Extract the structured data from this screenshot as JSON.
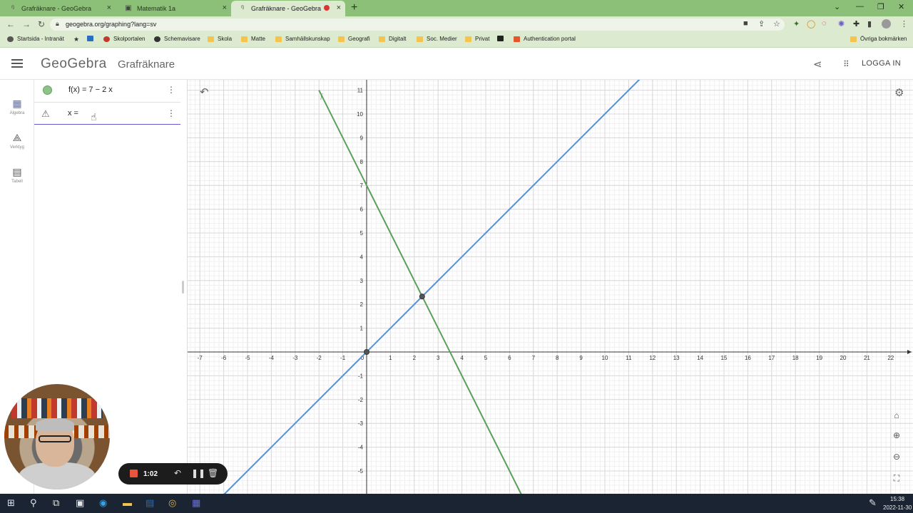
{
  "browser": {
    "tabs": [
      {
        "title": "Grafräknare - GeoGebra",
        "active": false,
        "icon": "geogebra-icon"
      },
      {
        "title": "Matematik 1a",
        "active": false,
        "icon": "video-icon"
      },
      {
        "title": "Grafräknare - GeoGebra",
        "active": true,
        "icon": "geogebra-icon"
      }
    ],
    "url": "geogebra.org/graphing?lang=sv",
    "bookmarks": [
      "Startsida - Intranät",
      "Skolportalen",
      "Schemavisare",
      "Skola",
      "Matte",
      "Samhällskunskap",
      "Geografi",
      "Digitalt",
      "Soc. Medier",
      "Privat",
      "Authentication portal"
    ],
    "other_bookmarks": "Övriga bokmärken"
  },
  "app": {
    "logo": "GeoGebra",
    "name": "Grafräknare",
    "login": "LOGGA IN"
  },
  "rail": {
    "items": [
      {
        "label": "Algebra",
        "icon": "calculator-icon"
      },
      {
        "label": "Verktyg",
        "icon": "tools-icon"
      },
      {
        "label": "Tabell",
        "icon": "table-icon"
      }
    ]
  },
  "algebra": {
    "rows": [
      {
        "expression": "f(x) = 7 − 2 x",
        "color": "#8bc486"
      },
      {
        "expression": "x =",
        "status": "warning"
      }
    ]
  },
  "graph": {
    "function_label": "f",
    "x_ticks": [
      "-7",
      "-6",
      "-5",
      "-4",
      "-3",
      "-2",
      "-1",
      "0",
      "1",
      "2",
      "3",
      "4",
      "5",
      "6",
      "7",
      "8",
      "9",
      "10",
      "11",
      "12",
      "13",
      "14",
      "15",
      "16",
      "17",
      "18",
      "19",
      "20",
      "21",
      "22"
    ],
    "y_ticks": [
      "11",
      "10",
      "9",
      "8",
      "7",
      "6",
      "5",
      "4",
      "3",
      "2",
      "1",
      "-1",
      "-2",
      "-3",
      "-4",
      "-5"
    ]
  },
  "chart_data": {
    "type": "line",
    "xlim": [
      -7,
      22
    ],
    "ylim": [
      -5,
      11
    ],
    "grid": true,
    "series": [
      {
        "name": "f",
        "equation": "f(x) = 7 - 2x",
        "color": "#5aa05a",
        "x": [
          -2,
          6.5
        ],
        "y": [
          11,
          -6
        ]
      },
      {
        "equation": "y = x",
        "color": "#5b8fcf",
        "x": [
          -6,
          11.5
        ],
        "y": [
          -6,
          11.5
        ]
      }
    ],
    "points": [
      {
        "x": 0,
        "y": 0
      },
      {
        "x": 2.33,
        "y": 2.33
      }
    ]
  },
  "recorder": {
    "time": "1:02"
  },
  "taskbar": {
    "time": "15:38",
    "date": "2022-11-30"
  }
}
